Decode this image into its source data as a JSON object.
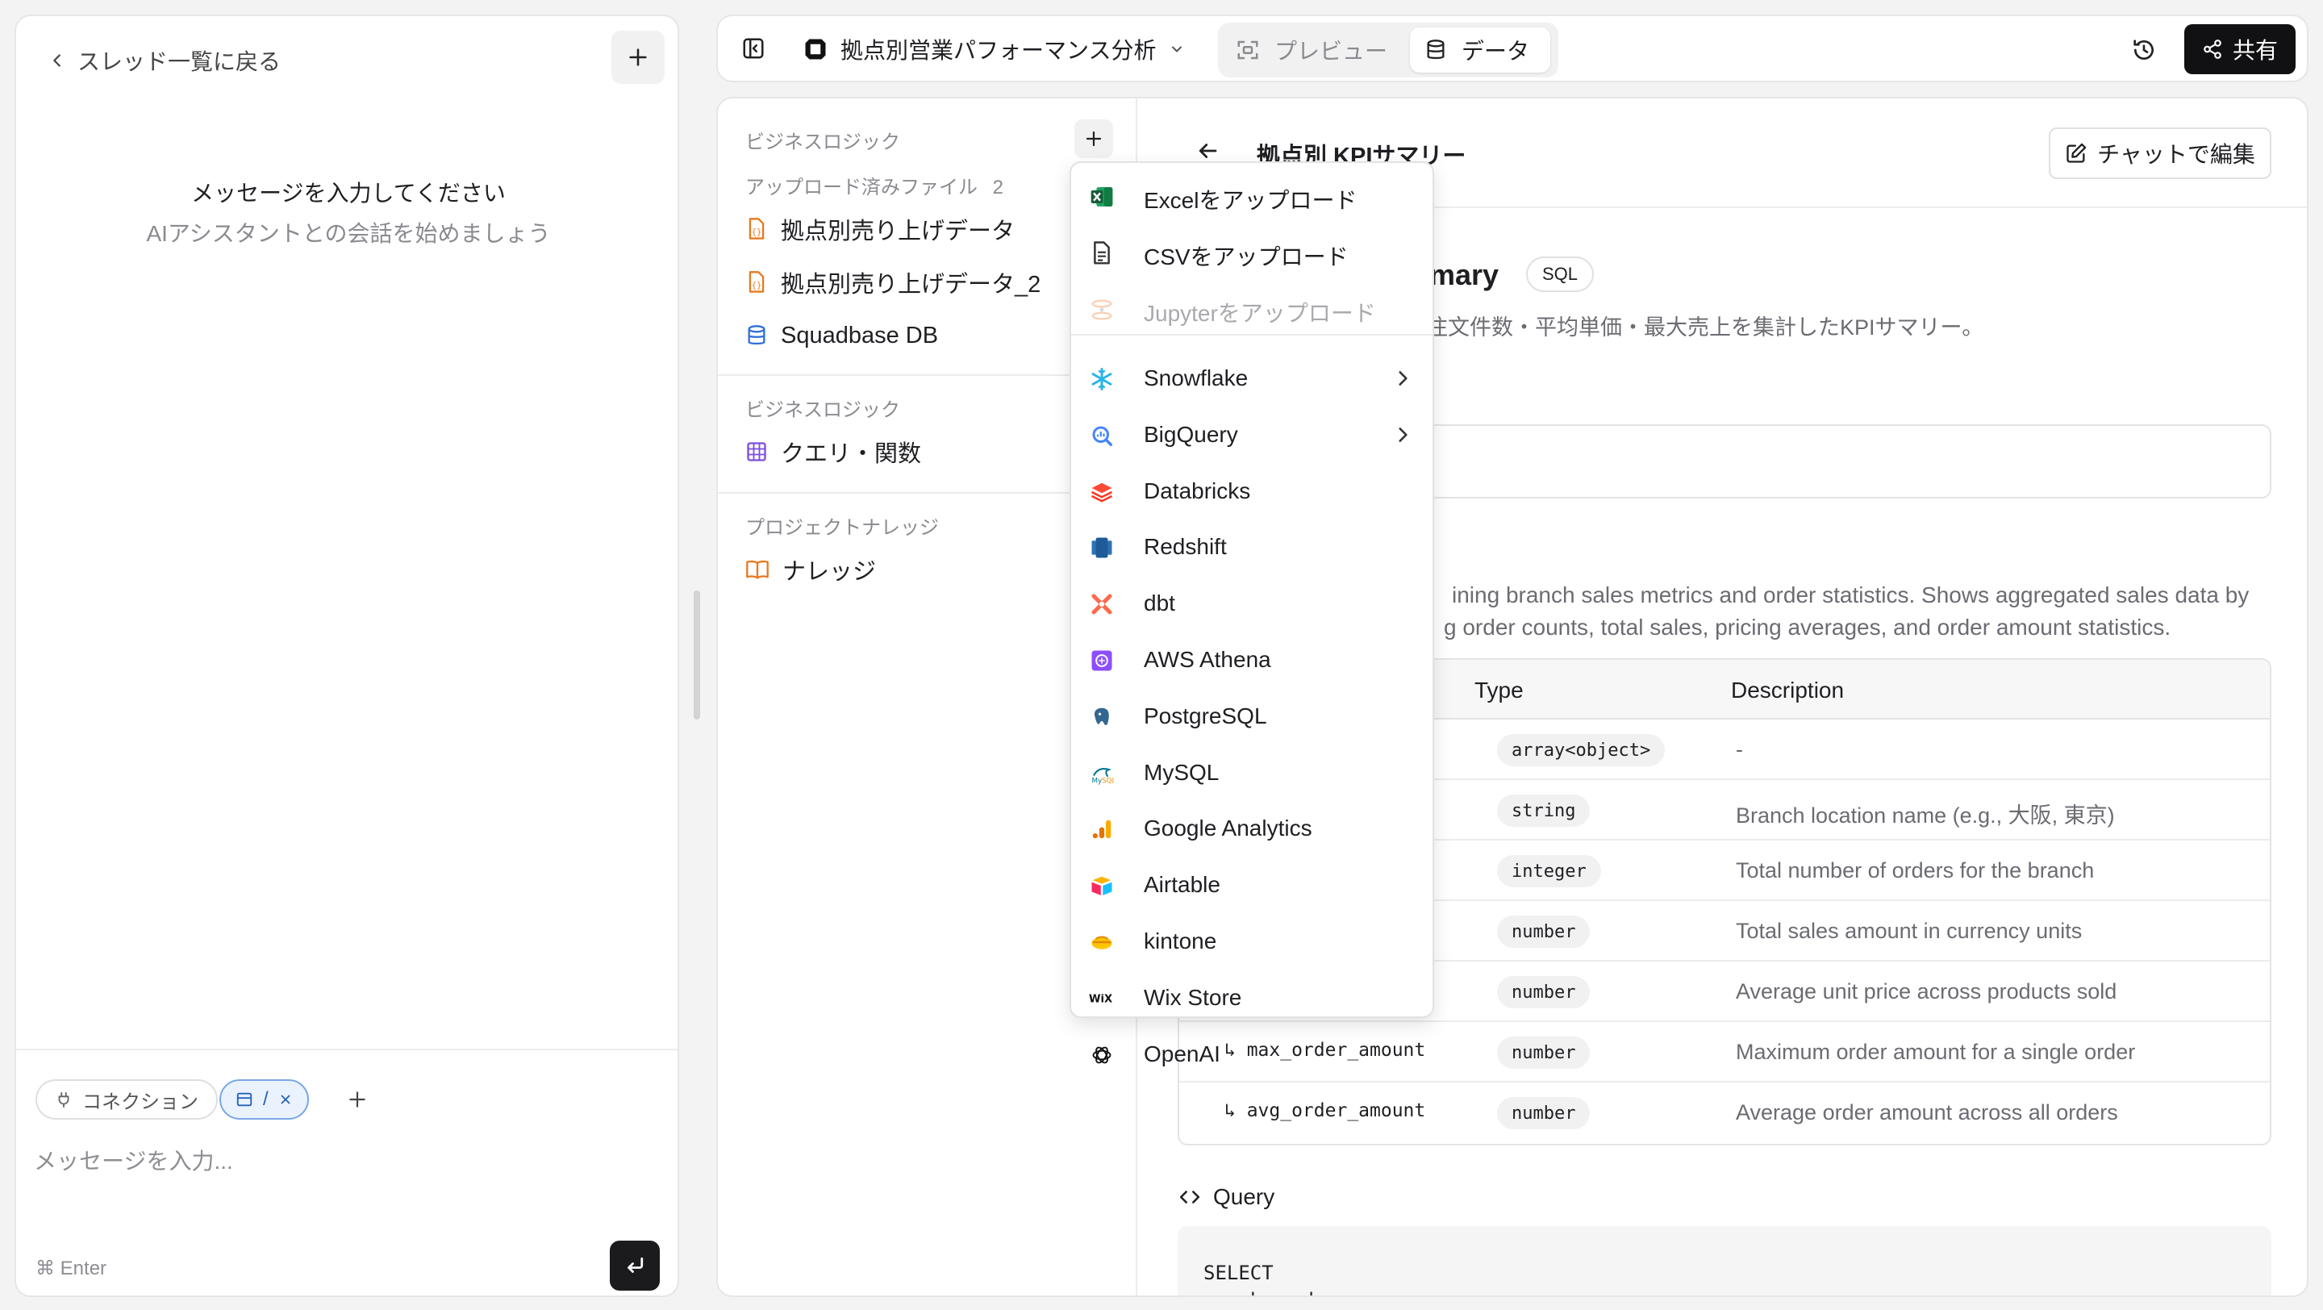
{
  "chat": {
    "back_label": "スレッド一覧に戻る",
    "empty_title": "メッセージを入力してください",
    "empty_subtitle": "AIアシスタントとの会話を始めましょう",
    "chip_connection": "コネクション",
    "chip_data": "/",
    "input_placeholder": "メッセージを入力...",
    "enter_hint": "⌘ Enter"
  },
  "topbar": {
    "project_title": "拠点別営業パフォーマンス分析",
    "tab_preview": "プレビュー",
    "tab_data": "データ",
    "share_label": "共有"
  },
  "filepanel": {
    "section_business_logic_top": "ビジネスロジック",
    "section_uploaded": "アップロード済みファイル",
    "uploaded_count": "2",
    "files": [
      {
        "label": "拠点別売り上げデータ",
        "icon": "json-file-icon"
      },
      {
        "label": "拠点別売り上げデータ_2",
        "icon": "json-file-icon"
      },
      {
        "label": "Squadbase DB",
        "icon": "database-icon"
      }
    ],
    "section_business_logic": "ビジネスロジック",
    "queries_label": "クエリ・関数",
    "section_knowledge": "プロジェクトナレッジ",
    "knowledge_label": "ナレッジ"
  },
  "content": {
    "page_title": "拠点別 KPIサマリー",
    "edit_chat_label": "チャットで編集",
    "query_name_visible": "mmary",
    "sql_badge": "SQL",
    "query_description_visible": "注文件数・平均単価・最大売上を集計したKPIサマリー。",
    "schema_desc_line1": "ining branch sales metrics and order statistics. Shows aggregated sales data by",
    "schema_desc_line2": "g order counts, total sales, pricing averages, and order amount statistics.",
    "table": {
      "headers": {
        "type": "Type",
        "description": "Description"
      },
      "rows": [
        {
          "name": "",
          "type": "array<object>",
          "description": "-"
        },
        {
          "name": "",
          "type": "string",
          "description": "Branch location name (e.g., 大阪, 東京)"
        },
        {
          "name": "",
          "type": "integer",
          "description": "Total number of orders for the branch"
        },
        {
          "name": "",
          "type": "number",
          "description": "Total sales amount in currency units"
        },
        {
          "name": "",
          "type": "number",
          "description": "Average unit price across products sold"
        },
        {
          "name": "↳ max_order_amount",
          "type": "number",
          "description": "Maximum order amount for a single order"
        },
        {
          "name": "↳ avg_order_amount",
          "type": "number",
          "description": "Average order amount across all orders"
        }
      ]
    },
    "query_heading": "Query",
    "code_line1": "SELECT",
    "code_line2": "branch,"
  },
  "dropdown": {
    "items": [
      {
        "label": "Excelをアップロード",
        "icon": "excel-icon",
        "disabled": false,
        "submenu": false
      },
      {
        "label": "CSVをアップロード",
        "icon": "csv-file-icon",
        "disabled": false,
        "submenu": false
      },
      {
        "label": "Jupyterをアップロード",
        "icon": "jupyter-icon",
        "disabled": true,
        "submenu": false
      },
      {
        "label": "Snowflake",
        "icon": "snowflake-icon",
        "disabled": false,
        "submenu": true
      },
      {
        "label": "BigQuery",
        "icon": "bigquery-icon",
        "disabled": false,
        "submenu": true
      },
      {
        "label": "Databricks",
        "icon": "databricks-icon",
        "disabled": false,
        "submenu": false
      },
      {
        "label": "Redshift",
        "icon": "redshift-icon",
        "disabled": false,
        "submenu": false
      },
      {
        "label": "dbt",
        "icon": "dbt-icon",
        "disabled": false,
        "submenu": false
      },
      {
        "label": "AWS Athena",
        "icon": "athena-icon",
        "disabled": false,
        "submenu": false
      },
      {
        "label": "PostgreSQL",
        "icon": "postgresql-icon",
        "disabled": false,
        "submenu": false
      },
      {
        "label": "MySQL",
        "icon": "mysql-icon",
        "disabled": false,
        "submenu": false
      },
      {
        "label": "Google Analytics",
        "icon": "google-analytics-icon",
        "disabled": false,
        "submenu": false
      },
      {
        "label": "Airtable",
        "icon": "airtable-icon",
        "disabled": false,
        "submenu": false
      },
      {
        "label": "kintone",
        "icon": "kintone-icon",
        "disabled": false,
        "submenu": false
      },
      {
        "label": "Wix Store",
        "icon": "wix-icon",
        "disabled": false,
        "submenu": false
      },
      {
        "label": "OpenAI",
        "icon": "openai-icon",
        "disabled": false,
        "submenu": false
      }
    ],
    "wix_logo_text": "WiX"
  },
  "colors": {
    "accent_blue": "#2563b8",
    "file_orange": "#e8791d",
    "db_blue": "#2f6fd6",
    "query_purple": "#7c4dde",
    "share_bg": "#111113"
  }
}
